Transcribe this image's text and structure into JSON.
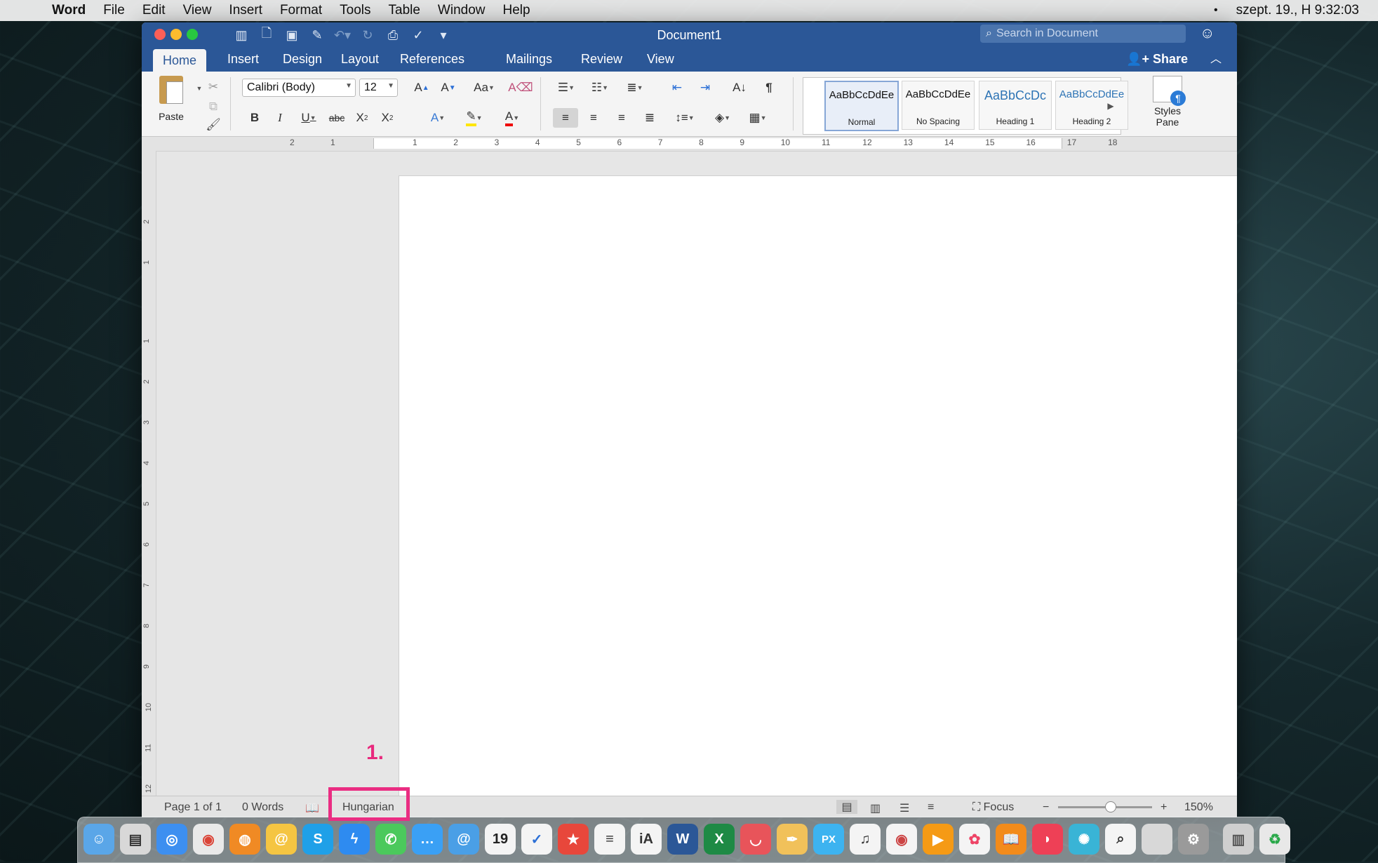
{
  "menubar": {
    "app_name": "Word",
    "items": [
      "File",
      "Edit",
      "View",
      "Insert",
      "Format",
      "Tools",
      "Table",
      "Window",
      "Help"
    ],
    "clock": "szept. 19., H  9:32:03"
  },
  "window": {
    "title": "Document1",
    "search_placeholder": "Search in Document",
    "share_label": "Share"
  },
  "tabs": [
    "Home",
    "Insert",
    "Design",
    "Layout",
    "References",
    "Mailings",
    "Review",
    "View"
  ],
  "ribbon": {
    "paste_label": "Paste",
    "font_name": "Calibri (Body)",
    "font_size": "12",
    "styles": [
      {
        "preview": "AaBbCcDdEe",
        "name": "Normal",
        "color": "#111111"
      },
      {
        "preview": "AaBbCcDdEe",
        "name": "No Spacing",
        "color": "#111111"
      },
      {
        "preview": "AaBbCcDc",
        "name": "Heading 1",
        "color": "#2e74b5"
      },
      {
        "preview": "AaBbCcDdEe",
        "name": "Heading 2",
        "color": "#2e74b5"
      }
    ],
    "styles_pane_label": "Styles Pane"
  },
  "ruler": {
    "h_ticks": [
      "2",
      "1",
      "1",
      "2",
      "3",
      "4",
      "5",
      "6",
      "7",
      "8",
      "9",
      "10",
      "11",
      "12",
      "13",
      "14",
      "15",
      "16",
      "17",
      "18"
    ],
    "v_ticks": [
      "2",
      "1",
      "1",
      "2",
      "3",
      "4",
      "5",
      "6",
      "7",
      "8",
      "9",
      "10",
      "11",
      "12"
    ]
  },
  "status": {
    "page": "Page 1 of 1",
    "words": "0 Words",
    "language": "Hungarian",
    "focus": "Focus",
    "zoom": "150%"
  },
  "annotation": {
    "label": "1."
  },
  "colors": {
    "accent": "#2b5797",
    "highlight": "#ea2d82"
  }
}
